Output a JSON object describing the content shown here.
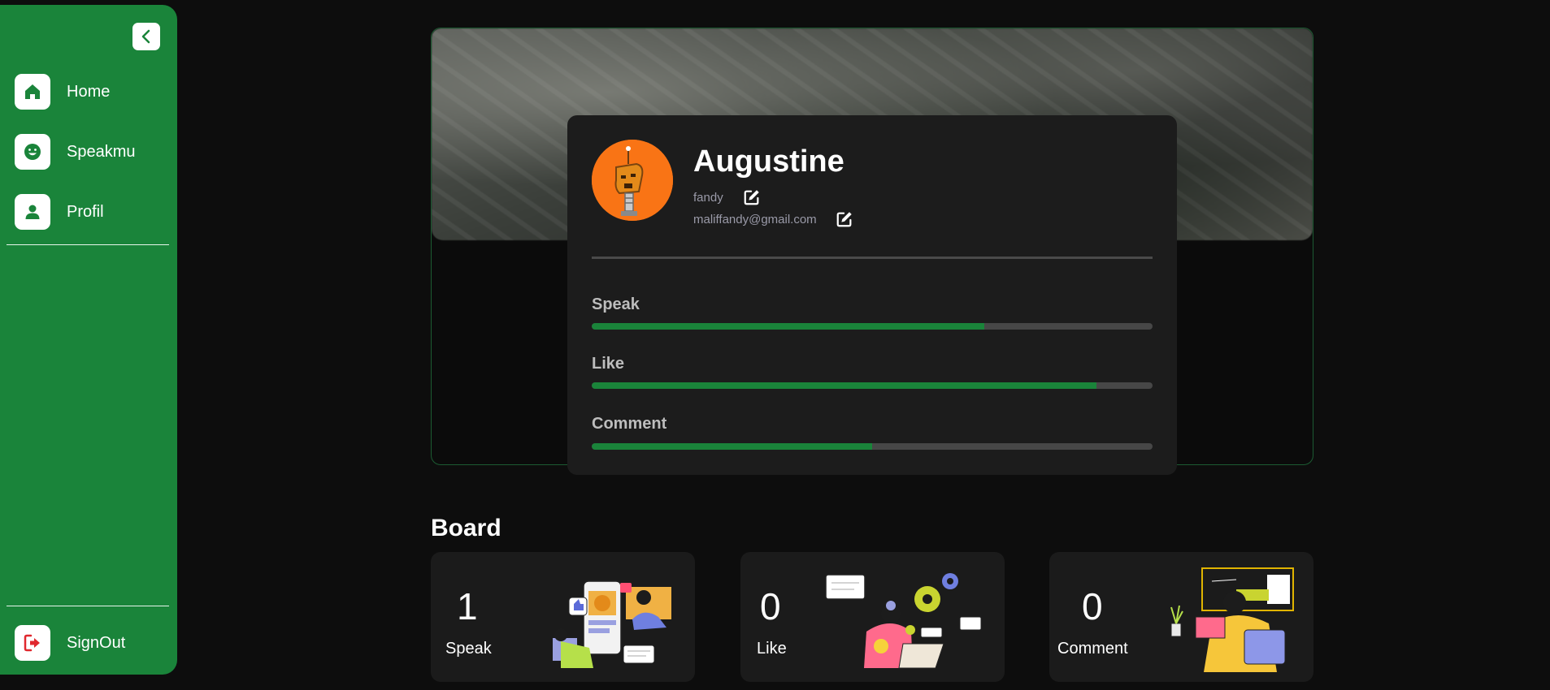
{
  "sidebar": {
    "items": [
      {
        "label": "Home",
        "icon": "home-icon"
      },
      {
        "label": "Speakmu",
        "icon": "smile-icon"
      },
      {
        "label": "Profil",
        "icon": "user-icon"
      }
    ],
    "signout_label": "SignOut",
    "accent": "#1a843a"
  },
  "profile": {
    "name": "Augustine",
    "username": "fandy",
    "email": "maliffandy@gmail.com",
    "avatar_color": "#f97415"
  },
  "stats": [
    {
      "label": "Speak",
      "progress": 0.7
    },
    {
      "label": "Like",
      "progress": 0.9
    },
    {
      "label": "Comment",
      "progress": 0.5
    }
  ],
  "board": {
    "title": "Board",
    "cards": [
      {
        "value": "1",
        "label": "Speak"
      },
      {
        "value": "0",
        "label": "Like"
      },
      {
        "value": "0",
        "label": "Comment"
      }
    ]
  }
}
